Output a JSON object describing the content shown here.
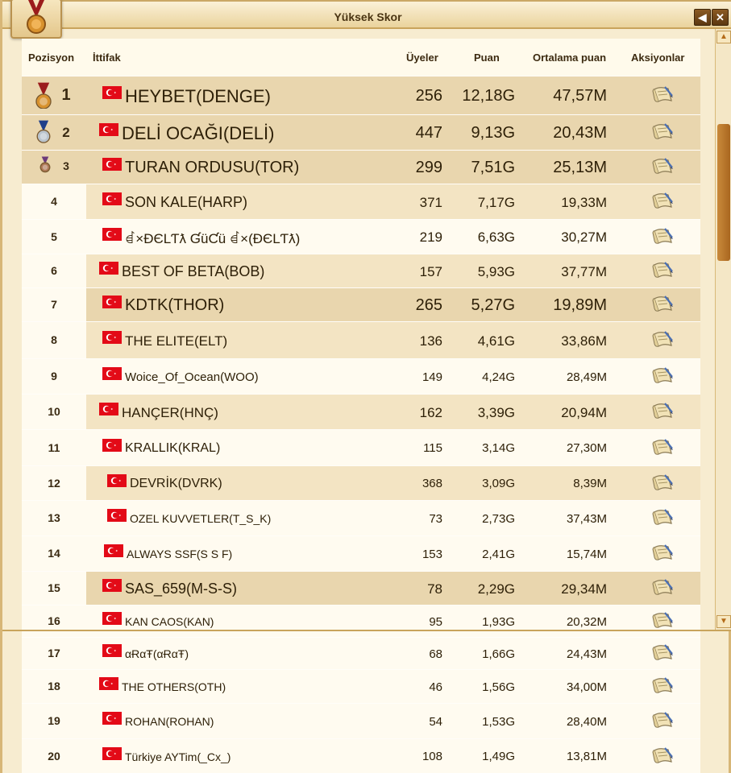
{
  "window": {
    "title": "Yüksek Skor"
  },
  "buttons": {
    "back": "◀",
    "close": "✕"
  },
  "columns": {
    "position": "Pozisyon",
    "alliance": "İttifak",
    "members": "Üyeler",
    "points": "Puan",
    "average": "Ortalama puan",
    "actions": "Aksiyonlar"
  },
  "colors": {
    "flag_red": "#e30a17",
    "gold": "#d8922e",
    "silver": "#b9c3cc",
    "bronze": "#b07a58",
    "ribbon_red": "#9b1c1c",
    "ribbon_blue": "#1f3f8a",
    "ribbon_purple": "#6b3a7a"
  },
  "rows": [
    {
      "pos": "1",
      "name": "HEYBET(DENGE)",
      "members": "256",
      "points": "12,18G",
      "avg": "47,57M",
      "medal": "gold",
      "size": 22,
      "shade": "dark"
    },
    {
      "pos": "2",
      "name": "DELİ OCAĞI(DELİ)",
      "members": "447",
      "points": "9,13G",
      "avg": "20,43M",
      "medal": "silver",
      "size": 22,
      "shade": "dark"
    },
    {
      "pos": "3",
      "name": "TURAN ORDUSU(TOR)",
      "members": "299",
      "points": "7,51G",
      "avg": "25,13M",
      "medal": "bronze",
      "size": 20,
      "shade": "dark"
    },
    {
      "pos": "4",
      "name": "SON KALE(HARP)",
      "members": "371",
      "points": "7,17G",
      "avg": "19,33M",
      "medal": "",
      "size": 18,
      "shade": "tan"
    },
    {
      "pos": "5",
      "name": "ꀸ×ƉЄLƬƛ ƓüƇü ꀸ×(ƉЄLƬƛ)",
      "members": "219",
      "points": "6,63G",
      "avg": "30,27M",
      "medal": "",
      "size": 17,
      "shade": "light"
    },
    {
      "pos": "6",
      "name": "BEST OF BETA(BOB)",
      "members": "157",
      "points": "5,93G",
      "avg": "37,77M",
      "medal": "",
      "size": 18,
      "shade": "tan"
    },
    {
      "pos": "7",
      "name": "KDTK(THOR)",
      "members": "265",
      "points": "5,27G",
      "avg": "19,89M",
      "medal": "",
      "size": 20,
      "shade": "dark"
    },
    {
      "pos": "8",
      "name": "THE ELITE(ELT)",
      "members": "136",
      "points": "4,61G",
      "avg": "33,86M",
      "medal": "",
      "size": 17,
      "shade": "tan"
    },
    {
      "pos": "9",
      "name": "Woice_Of_Ocean(WOO)",
      "members": "149",
      "points": "4,24G",
      "avg": "28,49M",
      "medal": "",
      "size": 15,
      "shade": "light"
    },
    {
      "pos": "10",
      "name": "HANÇER(HNÇ)",
      "members": "162",
      "points": "3,39G",
      "avg": "20,94M",
      "medal": "",
      "size": 17,
      "shade": "tan"
    },
    {
      "pos": "11",
      "name": "KRALLIK(KRAL)",
      "members": "115",
      "points": "3,14G",
      "avg": "27,30M",
      "medal": "",
      "size": 16,
      "shade": "light"
    },
    {
      "pos": "12",
      "name": "DEVRİK(DVRK)",
      "members": "368",
      "points": "3,09G",
      "avg": "8,39M",
      "medal": "",
      "size": 16,
      "shade": "tan"
    },
    {
      "pos": "13",
      "name": "OZEL KUVVETLER(T_S_K)",
      "members": "73",
      "points": "2,73G",
      "avg": "37,43M",
      "medal": "",
      "size": 14,
      "shade": "light"
    },
    {
      "pos": "14",
      "name": "ALWAYS SSF(S S F)",
      "members": "153",
      "points": "2,41G",
      "avg": "15,74M",
      "medal": "",
      "size": 14,
      "shade": "light"
    },
    {
      "pos": "15",
      "name": "SAS_659(M-S-S)",
      "members": "78",
      "points": "2,29G",
      "avg": "29,34M",
      "medal": "",
      "size": 18,
      "shade": "dark"
    },
    {
      "pos": "16",
      "name": "KAN CAOS(KAN)",
      "members": "95",
      "points": "1,93G",
      "avg": "20,32M",
      "medal": "",
      "size": 14,
      "shade": "light"
    },
    {
      "pos": "17",
      "name": "αɌαŦ(αɌαŦ)",
      "members": "68",
      "points": "1,66G",
      "avg": "24,43M",
      "medal": "",
      "size": 14,
      "shade": "light"
    },
    {
      "pos": "18",
      "name": "THE OTHERS(OTH)",
      "members": "46",
      "points": "1,56G",
      "avg": "34,00M",
      "medal": "",
      "size": 14,
      "shade": "light"
    },
    {
      "pos": "19",
      "name": "ROHAN(ROHAN)",
      "members": "54",
      "points": "1,53G",
      "avg": "28,40M",
      "medal": "",
      "size": 14,
      "shade": "light"
    },
    {
      "pos": "20",
      "name": "Türkiye AYTim(_Cx_)",
      "members": "108",
      "points": "1,49G",
      "avg": "13,81M",
      "medal": "",
      "size": 14,
      "shade": "light"
    }
  ]
}
